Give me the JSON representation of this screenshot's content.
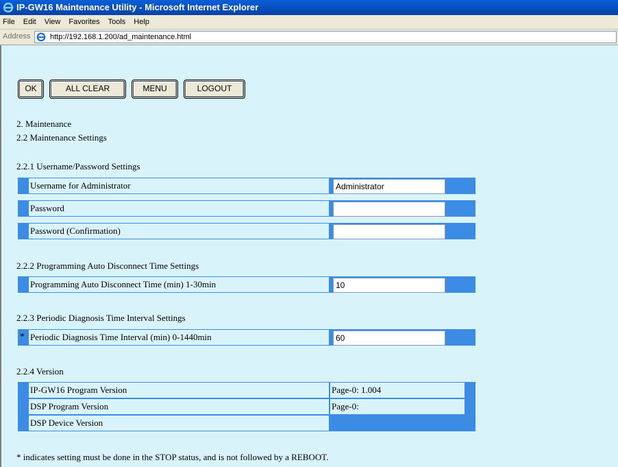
{
  "window": {
    "title": "IP-GW16 Maintenance Utility - Microsoft Internet Explorer"
  },
  "menu": [
    "File",
    "Edit",
    "View",
    "Favorites",
    "Tools",
    "Help"
  ],
  "address": {
    "label": "Address",
    "url": "http://192.168.1.200/ad_maintenance.html"
  },
  "buttons": {
    "ok": "OK",
    "all_clear": "ALL CLEAR",
    "menu": "MENU",
    "logout": "LOGOUT"
  },
  "heading": {
    "section": "2. Maintenance",
    "subsection": "2.2 Maintenance Settings"
  },
  "user_pw": {
    "title": "2.2.1 Username/Password Settings",
    "rows": [
      {
        "label": "Username for Administrator",
        "value": "Administrator"
      },
      {
        "label": "Password",
        "value": ""
      },
      {
        "label": "Password (Confirmation)",
        "value": ""
      }
    ]
  },
  "auto_disconnect": {
    "title": "2.2.2 Programming Auto Disconnect Time Settings",
    "label": "Programming Auto Disconnect Time (min) 1-30min",
    "value": "10"
  },
  "diagnosis": {
    "title": "2.2.3 Periodic Diagnosis Time Interval Settings",
    "marker": "*",
    "label": "Periodic Diagnosis Time Interval (min) 0-1440min",
    "value": "60"
  },
  "version": {
    "title": "2.2.4 Version",
    "rows": [
      {
        "label": "IP-GW16 Program Version",
        "value": "Page-0: 1.004"
      },
      {
        "label": "DSP Program Version",
        "value": "Page-0:"
      },
      {
        "label": "DSP Device Version",
        "value": ""
      }
    ]
  },
  "footnote": "* indicates setting must be done in the STOP status, and is not followed by a REBOOT."
}
